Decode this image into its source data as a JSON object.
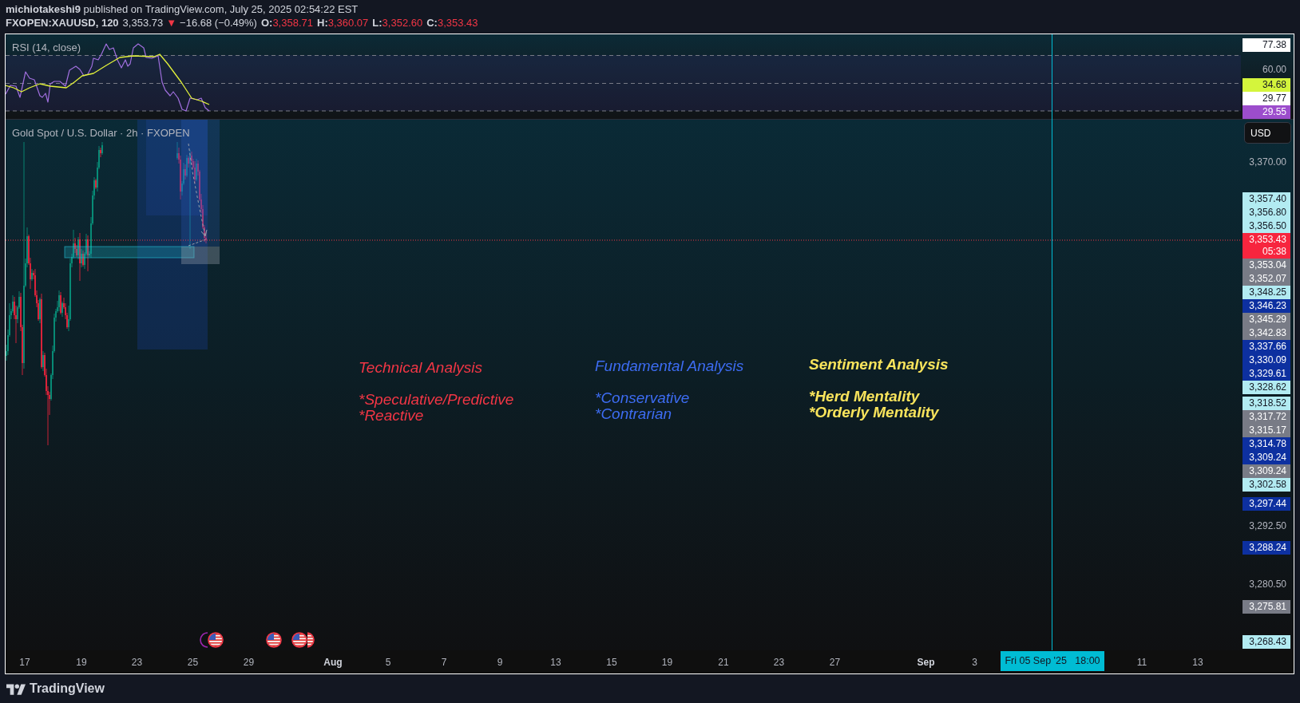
{
  "header": {
    "byline": "**michiotakeshi9** published on TradingView.com, July 25, 2025 02:54:22 EST",
    "symbol": "FXOPEN:XAUUSD, 120",
    "last": "3,353.73",
    "change": {
      "arrow": "▼",
      "text": "−16.68 (−0.49%)",
      "negative": true
    },
    "ohlc": [
      {
        "label": "O:",
        "value": "3,358.71"
      },
      {
        "label": "H:",
        "value": "3,360.07"
      },
      {
        "label": "L:",
        "value": "3,352.60"
      },
      {
        "label": "C:",
        "value": "3,353.43"
      }
    ]
  },
  "rsi_pane": {
    "title": "RSI (14, close)",
    "axis_labels": [
      {
        "kind": "tag",
        "text": "77.38",
        "color": "#ffffff"
      },
      {
        "kind": "tick",
        "text": "60.00"
      },
      {
        "kind": "tag",
        "text": "34.68",
        "color": "#d4f53c"
      },
      {
        "kind": "tag",
        "text": "29.77",
        "color": "#ffffff"
      },
      {
        "kind": "tag",
        "text": "29.55",
        "color": "#9c4dcc"
      }
    ]
  },
  "main_pane": {
    "title": "Gold Spot / U.S. Dollar · 2h · FXOPEN",
    "currency_button": "USD",
    "axis_labels": [
      {
        "kind": "tick",
        "text": "3,370.00"
      },
      {
        "kind": "tag",
        "text": "3,357.40",
        "color": "#b2ebf2"
      },
      {
        "kind": "tag",
        "text": "3,356.80",
        "color": "#b2ebf2"
      },
      {
        "kind": "tag",
        "text": "3,356.50",
        "color": "#b2ebf2"
      },
      {
        "kind": "tag",
        "text": "3,353.43",
        "countdown": "05:38",
        "color": "#f7253e"
      },
      {
        "kind": "tag",
        "text": "3,353.04",
        "color": "#787b86"
      },
      {
        "kind": "tag",
        "text": "3,352.07",
        "color": "#787b86"
      },
      {
        "kind": "tag",
        "text": "3,348.25",
        "color": "#b2ebf2"
      },
      {
        "kind": "tag",
        "text": "3,346.23",
        "color": "#0d30a0"
      },
      {
        "kind": "tag",
        "text": "3,345.29",
        "color": "#787b86"
      },
      {
        "kind": "tag",
        "text": "3,342.83",
        "color": "#787b86"
      },
      {
        "kind": "tag",
        "text": "3,337.66",
        "color": "#0d30a0"
      },
      {
        "kind": "tag",
        "text": "3,330.09",
        "color": "#0d30a0"
      },
      {
        "kind": "tag",
        "text": "3,329.61",
        "color": "#0d30a0"
      },
      {
        "kind": "tag",
        "text": "3,328.62",
        "color": "#b2ebf2"
      },
      {
        "kind": "tag",
        "text": "3,318.52",
        "color": "#b2ebf2"
      },
      {
        "kind": "tag",
        "text": "3,317.72",
        "color": "#787b86"
      },
      {
        "kind": "tag",
        "text": "3,315.17",
        "color": "#787b86"
      },
      {
        "kind": "tag",
        "text": "3,314.78",
        "color": "#0d30a0"
      },
      {
        "kind": "tag",
        "text": "3,309.24",
        "color": "#0d30a0"
      },
      {
        "kind": "tag",
        "text": "3,309.24",
        "color": "#787b86"
      },
      {
        "kind": "tag",
        "text": "3,302.58",
        "color": "#b2ebf2"
      },
      {
        "kind": "tag",
        "text": "3,297.44",
        "color": "#0d30a0"
      },
      {
        "kind": "tick",
        "text": "3,292.50"
      },
      {
        "kind": "tag",
        "text": "3,288.24",
        "color": "#0d30a0"
      },
      {
        "kind": "tick",
        "text": "3,280.50"
      },
      {
        "kind": "tag",
        "text": "3,275.81",
        "color": "#787b86"
      },
      {
        "kind": "tag",
        "text": "3,268.43",
        "color": "#b2ebf2"
      }
    ],
    "annotations": [
      {
        "title": "Technical Analysis",
        "items": [
          "*Speculative/Predictive",
          "*Reactive"
        ],
        "color": "#f23645",
        "bold": false
      },
      {
        "title": "Fundamental Analysis",
        "items": [
          "*Conservative",
          "*Contrarian"
        ],
        "color": "#3d6cf2",
        "bold": false
      },
      {
        "title": "Sentiment Analysis",
        "items": [
          "*Herd Mentality",
          "*Orderly Mentality"
        ],
        "color": "#f9e45c",
        "bold": true
      }
    ]
  },
  "time_axis": {
    "labels": [
      {
        "text": "17",
        "kind": "day"
      },
      {
        "text": "19",
        "kind": "day"
      },
      {
        "text": "23",
        "kind": "day"
      },
      {
        "text": "25",
        "kind": "day"
      },
      {
        "text": "29",
        "kind": "day"
      },
      {
        "text": "Aug",
        "kind": "month"
      },
      {
        "text": "5",
        "kind": "day"
      },
      {
        "text": "7",
        "kind": "day"
      },
      {
        "text": "9",
        "kind": "day"
      },
      {
        "text": "13",
        "kind": "day"
      },
      {
        "text": "15",
        "kind": "day"
      },
      {
        "text": "19",
        "kind": "day"
      },
      {
        "text": "21",
        "kind": "day"
      },
      {
        "text": "23",
        "kind": "day"
      },
      {
        "text": "27",
        "kind": "day"
      },
      {
        "text": "Sep",
        "kind": "month"
      },
      {
        "text": "3",
        "kind": "day"
      },
      {
        "text": "11",
        "kind": "day"
      },
      {
        "text": "13",
        "kind": "day"
      }
    ],
    "crosshair_label": "Fri 05 Sep '25   18:00"
  },
  "footer": {
    "logo_text": "TradingView"
  }
}
